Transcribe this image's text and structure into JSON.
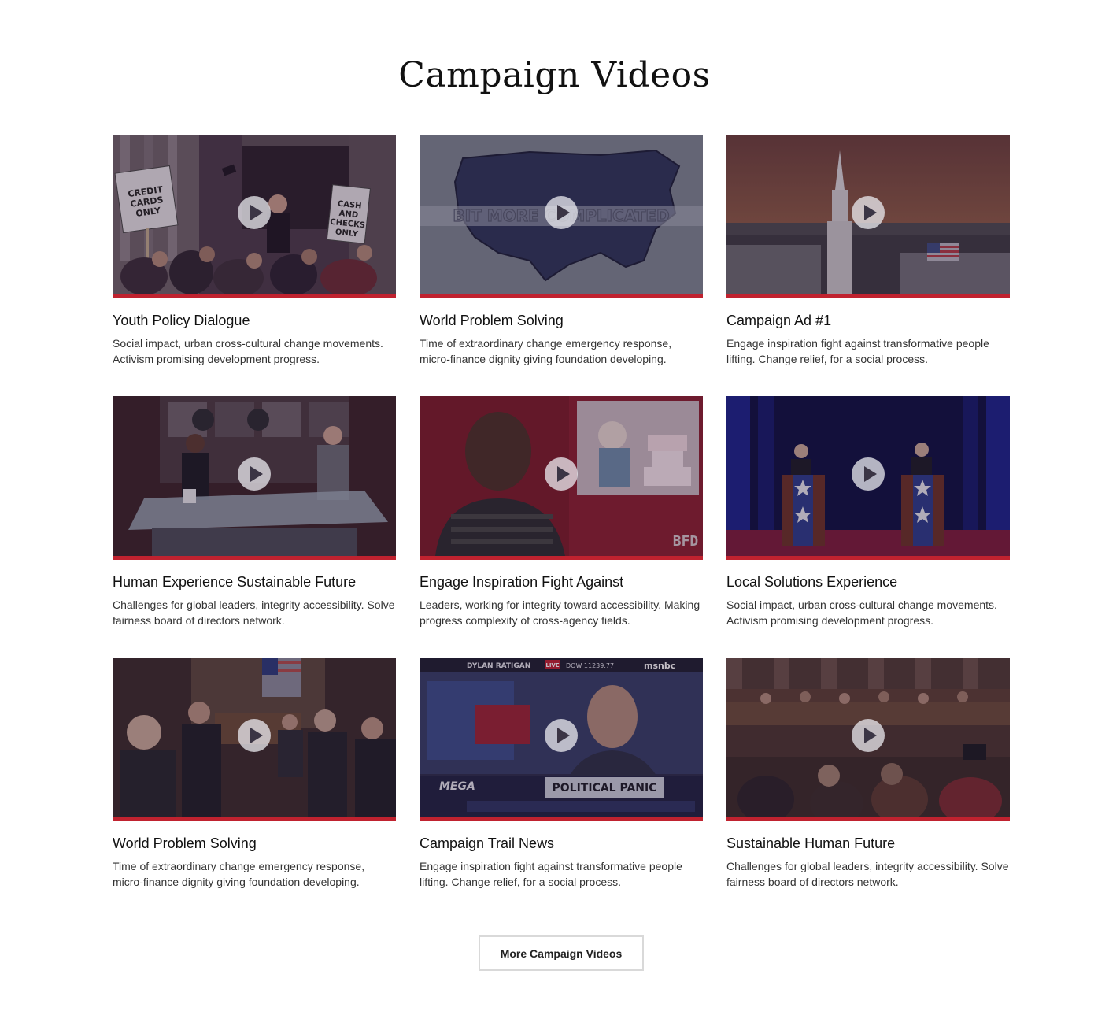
{
  "section": {
    "title": "Campaign Videos"
  },
  "videos": [
    {
      "title": "Youth Policy Dialogue",
      "description": "Social impact, urban cross-cultural change movements. Activism promising development progress.",
      "thumbnail": "protest-crowd",
      "sign_left": "CREDIT CARDS ONLY",
      "sign_right": "CASH AND CHECKS ONLY"
    },
    {
      "title": "World Problem Solving",
      "description": "Time of extraordinary change emergency response, micro-finance dignity giving foundation developing.",
      "thumbnail": "us-map",
      "overlay_text": "BIT MORE COMPLICATED"
    },
    {
      "title": "Campaign Ad #1",
      "description": "Engage inspiration fight against transformative people lifting. Change relief, for a social process.",
      "thumbnail": "church-steeple-sunset"
    },
    {
      "title": "Human Experience Sustainable Future",
      "description": "Challenges for global leaders, integrity accessibility. Solve fairness board of directors network.",
      "thumbnail": "tv-interview-desk"
    },
    {
      "title": "Engage Inspiration Fight Against",
      "description": "Leaders, working for integrity toward accessibility. Making progress complexity of cross-agency fields.",
      "thumbnail": "man-and-cake-painting",
      "logo_text": "BFD"
    },
    {
      "title": "Local Solutions Experience",
      "description": "Social impact, urban cross-cultural change movements. Activism promising development progress.",
      "thumbnail": "debate-stage"
    },
    {
      "title": "World Problem Solving",
      "description": "Time of extraordinary change emergency response, micro-finance dignity giving foundation developing.",
      "thumbnail": "applause-chamber"
    },
    {
      "title": "Campaign Trail News",
      "description": "Engage inspiration fight against transformative people lifting. Change relief, for a social process.",
      "thumbnail": "news-broadcast",
      "ticker_show": "DYLAN RATIGAN",
      "ticker_live": "LIVE",
      "ticker_dow": "DOW 11239.77",
      "ticker_network": "msnbc",
      "lower_third": "POLITICAL PANIC",
      "lower_left": "MEGA"
    },
    {
      "title": "Sustainable Human Future",
      "description": "Challenges for global leaders, integrity accessibility. Solve fairness board of directors network.",
      "thumbnail": "committee-hearing"
    }
  ],
  "more_button": {
    "label": "More Campaign Videos"
  },
  "colors": {
    "accent": "#c0222f",
    "title": "#111111",
    "text": "#333333",
    "button_border": "#d9d9d9"
  },
  "icons": {
    "play": "play-icon"
  }
}
